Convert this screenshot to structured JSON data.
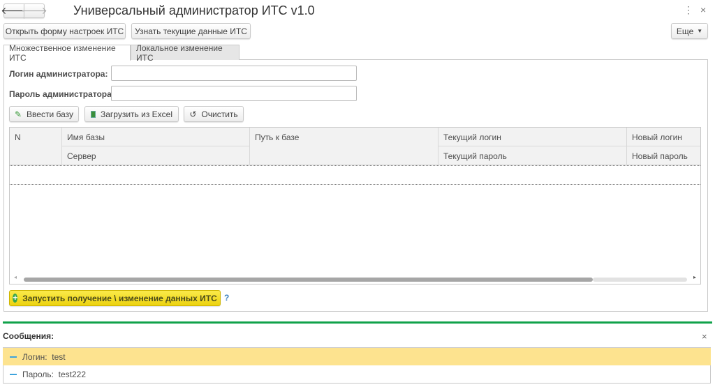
{
  "window": {
    "title": "Универсальный администратор ИТС v1.0",
    "more_icon": "⋮",
    "close_icon": "×"
  },
  "toolbar": {
    "open_settings": "Открыть форму настроек ИТС",
    "get_current": "Узнать текущие данные ИТС",
    "more": "Еще"
  },
  "tabs": [
    {
      "label": "Множественное изменение ИТС"
    },
    {
      "label": "Локальное изменение ИТС"
    }
  ],
  "form": {
    "login_label": "Логин администратора:",
    "password_label": "Пароль администратора:",
    "login_value": "",
    "password_value": ""
  },
  "actions": {
    "enter_base": "Ввести базу",
    "load_excel": "Загрузить из Excel",
    "clear": "Очистить"
  },
  "table": {
    "headers": {
      "n": "N",
      "base_name": "Имя базы",
      "server": "Сервер",
      "path": "Путь к базе",
      "cur_login": "Текущий логин",
      "cur_password": "Текущий пароль",
      "new_login": "Новый логин",
      "new_password": "Новый пароль"
    },
    "rows": []
  },
  "run": {
    "label": "Запустить получение \\ изменение данных ИТС",
    "help": "?"
  },
  "messages": {
    "title": "Сообщения:",
    "items": [
      {
        "key": "Логин:",
        "value": "test"
      },
      {
        "key": "Пароль:",
        "value": "test222"
      }
    ]
  },
  "colors": {
    "accent_green": "#10a24a",
    "run_yellow": "#f5e027",
    "selected_msg": "#fde38f"
  }
}
